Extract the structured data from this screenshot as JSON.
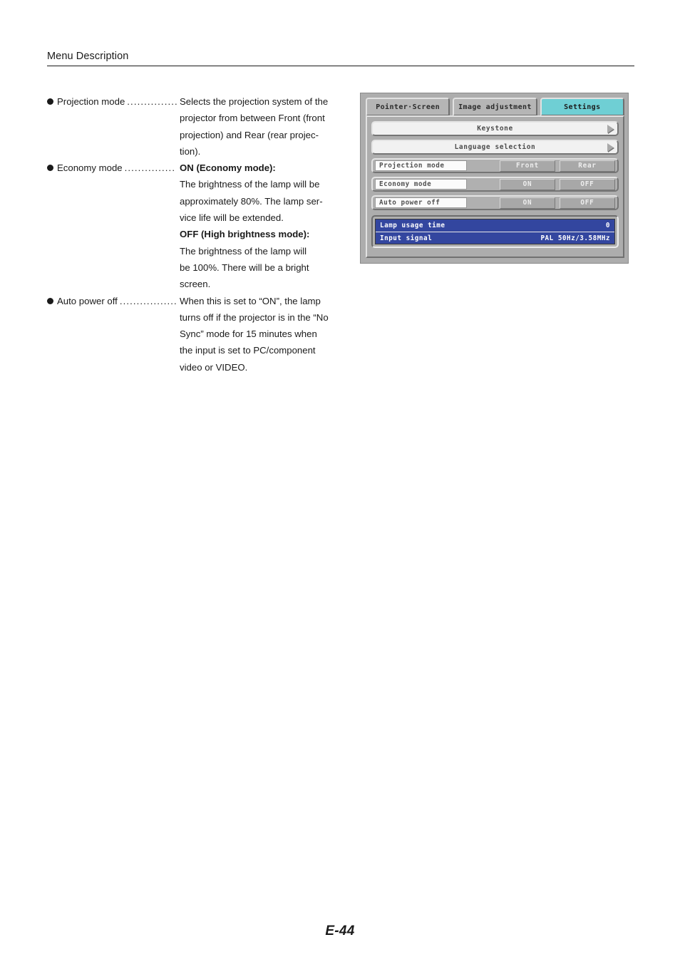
{
  "header": {
    "running_head": "Menu Description"
  },
  "descriptions": [
    {
      "bullet_icon": "filled-circle-bullet",
      "term": "Projection mode",
      "leader": "...............",
      "lines": [
        {
          "text": "Selects the projection system of the",
          "bold": false
        },
        {
          "text": "projector from between Front (front",
          "bold": false
        },
        {
          "text": "projection) and Rear (rear projec-",
          "bold": false
        },
        {
          "text": "tion).",
          "bold": false,
          "last": true
        }
      ]
    },
    {
      "bullet_icon": "filled-circle-bullet",
      "term": "Economy mode",
      "leader": "...............",
      "lines": [
        {
          "text": "ON (Economy mode):",
          "bold": true,
          "last": true
        },
        {
          "text": "The brightness of the lamp will be",
          "bold": false
        },
        {
          "text": "approximately 80%. The lamp ser-",
          "bold": false
        },
        {
          "text": "vice life will be extended.",
          "bold": false,
          "last": true
        },
        {
          "text": "OFF (High brightness mode):",
          "bold": true,
          "last": true
        },
        {
          "text": "The brightness of the lamp will",
          "bold": false
        },
        {
          "text": "be 100%. There will be a bright",
          "bold": false
        },
        {
          "text": "screen.",
          "bold": false,
          "last": true
        }
      ]
    },
    {
      "bullet_icon": "filled-circle-bullet",
      "term": "Auto power off",
      "leader": ".................",
      "lines": [
        {
          "text": "When this is set to “ON”, the lamp",
          "bold": false
        },
        {
          "text": "turns off if the projector is in the “No",
          "bold": false
        },
        {
          "text": "Sync” mode for 15 minutes when",
          "bold": false
        },
        {
          "text": "the input is set to PC/component",
          "bold": false
        },
        {
          "text": "video or VIDEO.",
          "bold": false,
          "last": true
        }
      ]
    }
  ],
  "osd": {
    "colors": {
      "selected_tab": "#6fcfd4",
      "panel_grey": "#adadad",
      "info_blue": "#33469f"
    },
    "tabs": [
      {
        "label": "Pointer·Screen",
        "selected": false
      },
      {
        "label": "Image adjustment",
        "selected": false
      },
      {
        "label": "Settings",
        "selected": true
      }
    ],
    "menu_rows": [
      {
        "label": "Keystone",
        "arrow_icon": "arrow-right-icon"
      },
      {
        "label": "Language selection",
        "arrow_icon": "arrow-right-icon"
      }
    ],
    "option_rows": [
      {
        "label": "Projection mode",
        "option_a": "Front",
        "option_b": "Rear"
      },
      {
        "label": "Economy mode",
        "option_a": "ON",
        "option_b": "OFF"
      },
      {
        "label": "Auto power off",
        "option_a": "ON",
        "option_b": "OFF"
      }
    ],
    "info_rows": [
      {
        "label": "Lamp usage time",
        "value": "0"
      },
      {
        "label": "Input signal",
        "value": "PAL 50Hz/3.58MHz"
      }
    ]
  },
  "footer": {
    "page_number": "E-44"
  }
}
